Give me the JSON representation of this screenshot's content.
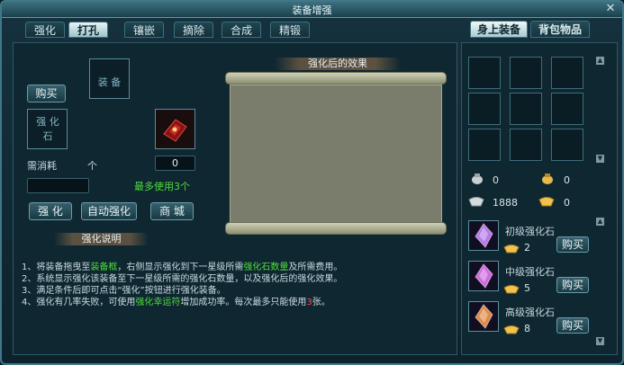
{
  "window": {
    "title": "装备增强",
    "close_icon": "close-icon"
  },
  "tabs": [
    "强化",
    "打孔",
    "镶嵌",
    "摘除",
    "合成",
    "精锻"
  ],
  "active_tab": "打孔",
  "right_tabs": [
    "身上装备",
    "背包物品"
  ],
  "left": {
    "buy_label": "购买",
    "equip_slot_label": "装 备",
    "stone_slot_label": "强 化 石",
    "consume_label": "需消耗",
    "unit_label": "个",
    "consume_count": "0",
    "max_use_label": "最多使用3个",
    "btn_strengthen": "强 化",
    "btn_auto": "自动强化",
    "btn_shop": "商 城",
    "effect_title": "强化后的效果",
    "desc_title": "强化说明"
  },
  "instructions": [
    {
      "num": "1、",
      "parts": [
        {
          "text": "将装备拖曳至",
          "hl": false
        },
        {
          "text": "装备框",
          "hl": true
        },
        {
          "text": "，右侧显示强化到下一星级所需",
          "hl": false
        },
        {
          "text": "强化石数量",
          "hl": true
        },
        {
          "text": "及所需费用。",
          "hl": false
        }
      ]
    },
    {
      "num": "2、",
      "parts": [
        {
          "text": "系统显示强化该装备至下一星级所需的强化石数量，以及强化后的强化效果。",
          "hl": false
        }
      ]
    },
    {
      "num": "3、",
      "parts": [
        {
          "text": "满足条件后即可点击“强化”按钮进行强化装备。",
          "hl": false
        }
      ]
    },
    {
      "num": "4、",
      "parts": [
        {
          "text": "强化有几率失败，可使用",
          "hl": false
        },
        {
          "text": "强化幸运符",
          "hl": true
        },
        {
          "text": "增加成功率。每次最多只能使用",
          "hl": false
        },
        {
          "text": "3",
          "red": true
        },
        {
          "text": "张。",
          "hl": false
        }
      ]
    }
  ],
  "currency": {
    "silver_bag": "0",
    "gold_bag": "0",
    "silver_ingot": "1888",
    "gold_ingot": "0"
  },
  "stones": [
    {
      "name": "初级强化石",
      "price": "2",
      "buy": "购买",
      "color": "#b57be8"
    },
    {
      "name": "中级强化石",
      "price": "5",
      "buy": "购买",
      "color": "#d06adf"
    },
    {
      "name": "高级强化石",
      "price": "8",
      "buy": "购买",
      "color": "#e0894a"
    }
  ]
}
